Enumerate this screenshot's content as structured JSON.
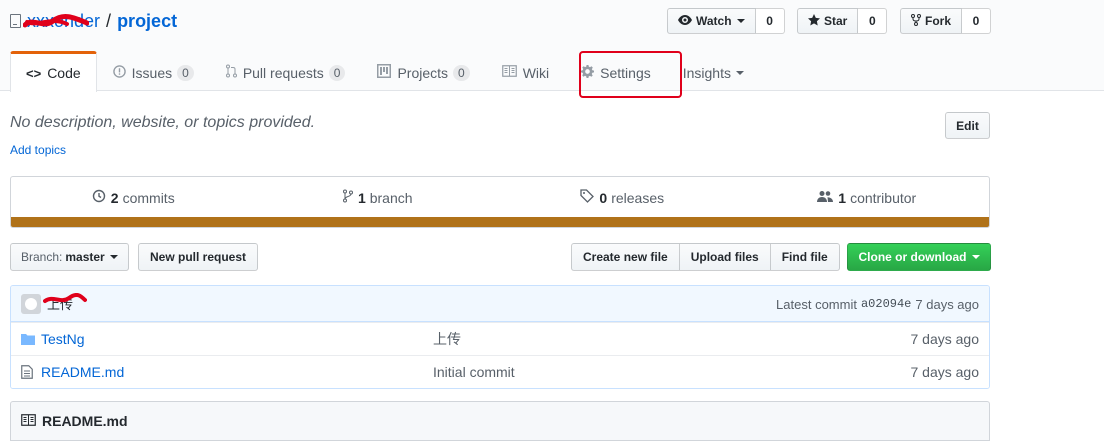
{
  "repo": {
    "owner": "xxxonder",
    "separator": "/",
    "name": "project"
  },
  "actions": {
    "watch": {
      "label": "Watch",
      "count": "0"
    },
    "star": {
      "label": "Star",
      "count": "0"
    },
    "fork": {
      "label": "Fork",
      "count": "0"
    }
  },
  "tabs": [
    {
      "label": "Code",
      "icon": "code-icon",
      "selected": true
    },
    {
      "label": "Issues",
      "counter": "0",
      "icon": "issue-icon"
    },
    {
      "label": "Pull requests",
      "counter": "0",
      "icon": "pull-request-icon"
    },
    {
      "label": "Projects",
      "counter": "0",
      "icon": "project-icon"
    },
    {
      "label": "Wiki",
      "icon": "book-icon"
    },
    {
      "label": "Settings",
      "icon": "gear-icon",
      "highlighted": true
    },
    {
      "label": "Insights",
      "icon": "chevron-down-icon"
    }
  ],
  "description": {
    "text": "No description, website, or topics provided.",
    "add_topics": "Add topics",
    "edit": "Edit"
  },
  "summary": {
    "commits_count": "2",
    "commits_label": "commits",
    "branch_count": "1",
    "branch_label": "branch",
    "releases_count": "0",
    "releases_label": "releases",
    "contributor_count": "1",
    "contributor_label": "contributor",
    "language_color": "#b07219"
  },
  "file_nav": {
    "branch_prefix": "Branch:",
    "branch_name": "master",
    "new_pull_request": "New pull request",
    "create_new_file": "Create new file",
    "upload_files": "Upload files",
    "find_file": "Find file",
    "clone_or_download": "Clone or download"
  },
  "commit_tease": {
    "message": "上传",
    "latest_label": "Latest commit",
    "sha": "a02094e",
    "age": "7 days ago"
  },
  "files": [
    {
      "name": "TestNg",
      "type": "folder",
      "message": "上传",
      "age": "7 days ago"
    },
    {
      "name": "README.md",
      "type": "file",
      "message": "Initial commit",
      "age": "7 days ago"
    }
  ],
  "readme": {
    "title": "README.md"
  },
  "colors": {
    "accent": "#0366d6",
    "tab_top": "#e36209",
    "highlight": "#e0001b",
    "clone": "#28a745"
  }
}
